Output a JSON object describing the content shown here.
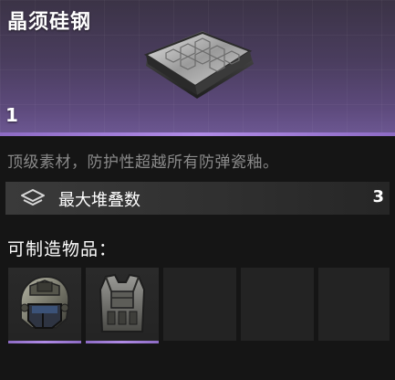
{
  "item": {
    "name": "晶须硅钢",
    "quantity": "1",
    "description": "顶级素材，防护性超越所有防弹瓷釉。",
    "rarity_color": "#8d6bc4"
  },
  "stats": {
    "label": "最大堆叠数",
    "value": "3",
    "icon": "stack-layers-icon"
  },
  "crafting": {
    "title": "可制造物品：",
    "slots": [
      {
        "icon": "helmet-icon",
        "filled": true
      },
      {
        "icon": "body-armor-icon",
        "filled": true
      },
      {
        "filled": false
      },
      {
        "filled": false
      },
      {
        "filled": false
      }
    ]
  }
}
